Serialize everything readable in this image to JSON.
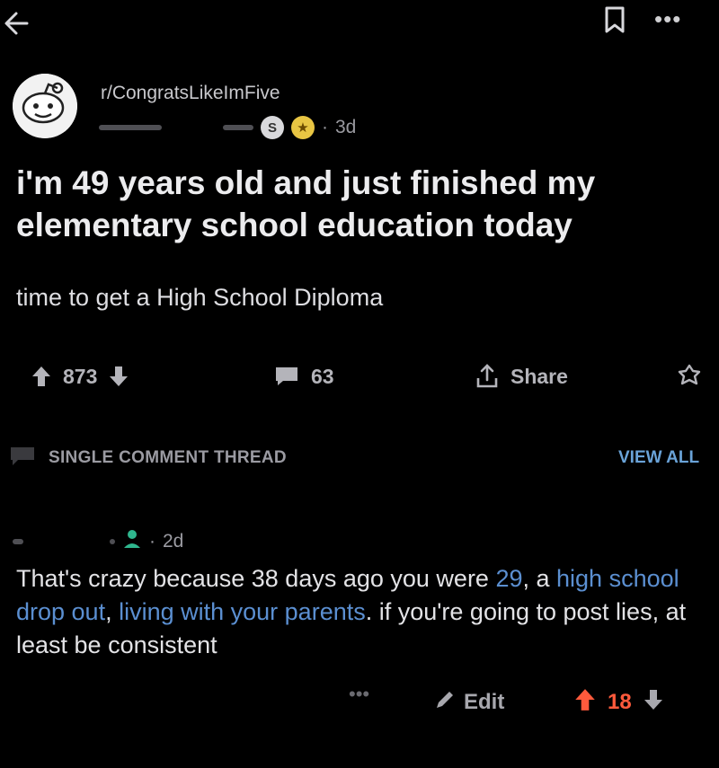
{
  "post": {
    "subreddit": "r/CongratsLikeImFive",
    "age": "3d",
    "title": "i'm 49 years old and just finished my elementary school education today",
    "body": "time to get a High School Diploma",
    "upvotes": "873",
    "comments": "63",
    "share_label": "Share"
  },
  "thread": {
    "label": "SINGLE COMMENT THREAD",
    "view_all": "VIEW ALL"
  },
  "comment": {
    "age": "2d",
    "text_part1": "That's crazy because 38 days ago you were ",
    "link1": "29",
    "text_part2": ", a ",
    "link2": "high school drop out",
    "text_part3": ", ",
    "link3": "living with your parents",
    "text_part4": ". if you're going to post lies, at least be consistent",
    "edit_label": "Edit",
    "votes": "18"
  },
  "colors": {
    "background": "#000000",
    "link": "#5b8fd1",
    "upvote_active": "#ff5a3c",
    "view_all": "#6aa3d8"
  },
  "icons": [
    "back-arrow-icon",
    "bookmark-icon",
    "more-icon",
    "reddit-avatar-icon",
    "silver-award-icon",
    "gold-award-icon",
    "upvote-icon",
    "downvote-icon",
    "comment-icon",
    "share-icon",
    "award-icon",
    "speech-bubble-icon",
    "user-icon",
    "pencil-icon"
  ]
}
